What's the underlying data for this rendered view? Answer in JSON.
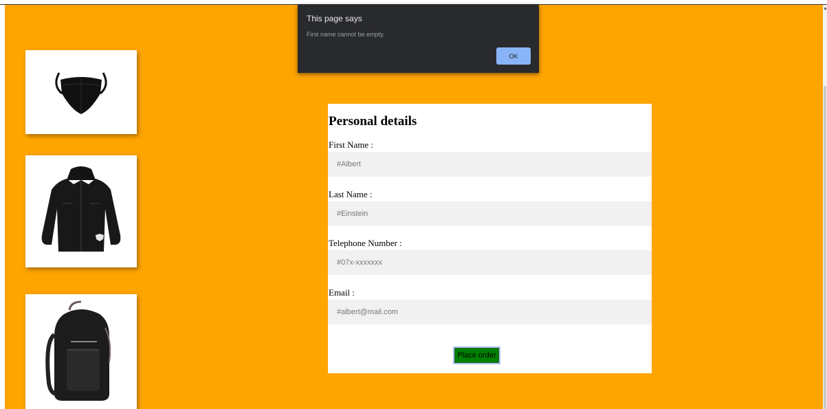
{
  "dialog": {
    "title": "This page says",
    "message": "First name cannot be empty.",
    "ok_label": "OK"
  },
  "products": [
    {
      "icon": "face-mask-icon"
    },
    {
      "icon": "jacket-icon"
    },
    {
      "icon": "backpack-icon"
    }
  ],
  "form": {
    "title": "Personal details",
    "fields": [
      {
        "label": "First Name :",
        "placeholder": "#Albert"
      },
      {
        "label": "Last Name :",
        "placeholder": "#Einstein"
      },
      {
        "label": "Telephone Number :",
        "placeholder": "#07x-xxxxxxx"
      },
      {
        "label": "Email :",
        "placeholder": "#albert@mail.com"
      }
    ],
    "submit_label": "Place order"
  },
  "colors": {
    "background": "#ffa500",
    "submit": "#008000",
    "dialog_bg": "#292a2d",
    "dialog_button": "#8ab4f8"
  }
}
